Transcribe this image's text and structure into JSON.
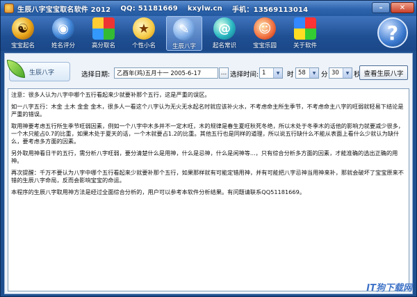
{
  "window": {
    "title": "生辰八字宝宝取名软件 2012",
    "qq": "QQ: 51181669",
    "site": "kxylw.cn",
    "phone": "手机：13569113014"
  },
  "toolbar": {
    "items": [
      {
        "label": "宝宝起名",
        "icon": "yin-yang-icon"
      },
      {
        "label": "姓名评分",
        "icon": "globe-icon"
      },
      {
        "label": "高分取名",
        "icon": "cubes-icon"
      },
      {
        "label": "个性小名",
        "icon": "sun-icon"
      },
      {
        "label": "生辰八字",
        "icon": "pen-icon"
      },
      {
        "label": "起名常识",
        "icon": "swirl-icon"
      },
      {
        "label": "宝宝乐园",
        "icon": "clown-icon"
      },
      {
        "label": "关于软件",
        "icon": "windows-icon"
      }
    ],
    "active": "生辰八字",
    "help_icon": "?"
  },
  "options": {
    "badge_label": "生辰八字",
    "date_label": "选择日期:",
    "date_value": "乙酉年(鸡)五月十一  2005-6-17",
    "dots": "...",
    "time_label": "选择时间:",
    "month_value": "1",
    "hour_label": "时",
    "minute_value": "58",
    "minute_label": "分",
    "second_value": "30",
    "second_label": "秒",
    "view_button": "查看生辰八字"
  },
  "content": {
    "paragraphs": [
      "注意：很多人认为八字中哪个五行看起来少就要补那个五行，这是严重的误区。",
      "如一八字五行：木金 土木 金金 金木，很多人一看这个八字认为无火无水起名时就应该补火水，不考虑命主所生季节，不考虑命主八字的旺弱就轻易下结论是严重的错误。",
      "取用神要考虑五行所生季节旺弱因素，例如一个八字中木多并不一定木旺，木的规律是春生夏旺秋死冬绝，所以木处于冬季木的话他的影响力就要减少很多，一个木只能占0.7的比重，如果木处于夏天的话，一个木就要占1.2的比重。其他五行也是同样的道理，所以说五行缺什么不能从表面上看什么少就认为缺什么，要考虑多方面的因素。",
      "另外取用神看日干的五行，需分析八字旺弱，要分清楚什么是用神，什么是忌神，什么是闲神等...，只有综合分析多方面的因素，才能准确的选出正确的用神。",
      "再次提醒：千万不要认为八字中哪个五行看起来少就要补那个五行，如果那样就有可能定错用神，并有可能把八字忌神当用神来补，那就会破坏了宝宝原来不错的生辰八字命局，反而会影响宝宝的命运。",
      "本程序的生辰八字取用神方法是经过全面综合分析的，用户可以参考本软件分析结果。有问题请联系QQ51181669。"
    ]
  },
  "watermark": "IT狗下载网"
}
